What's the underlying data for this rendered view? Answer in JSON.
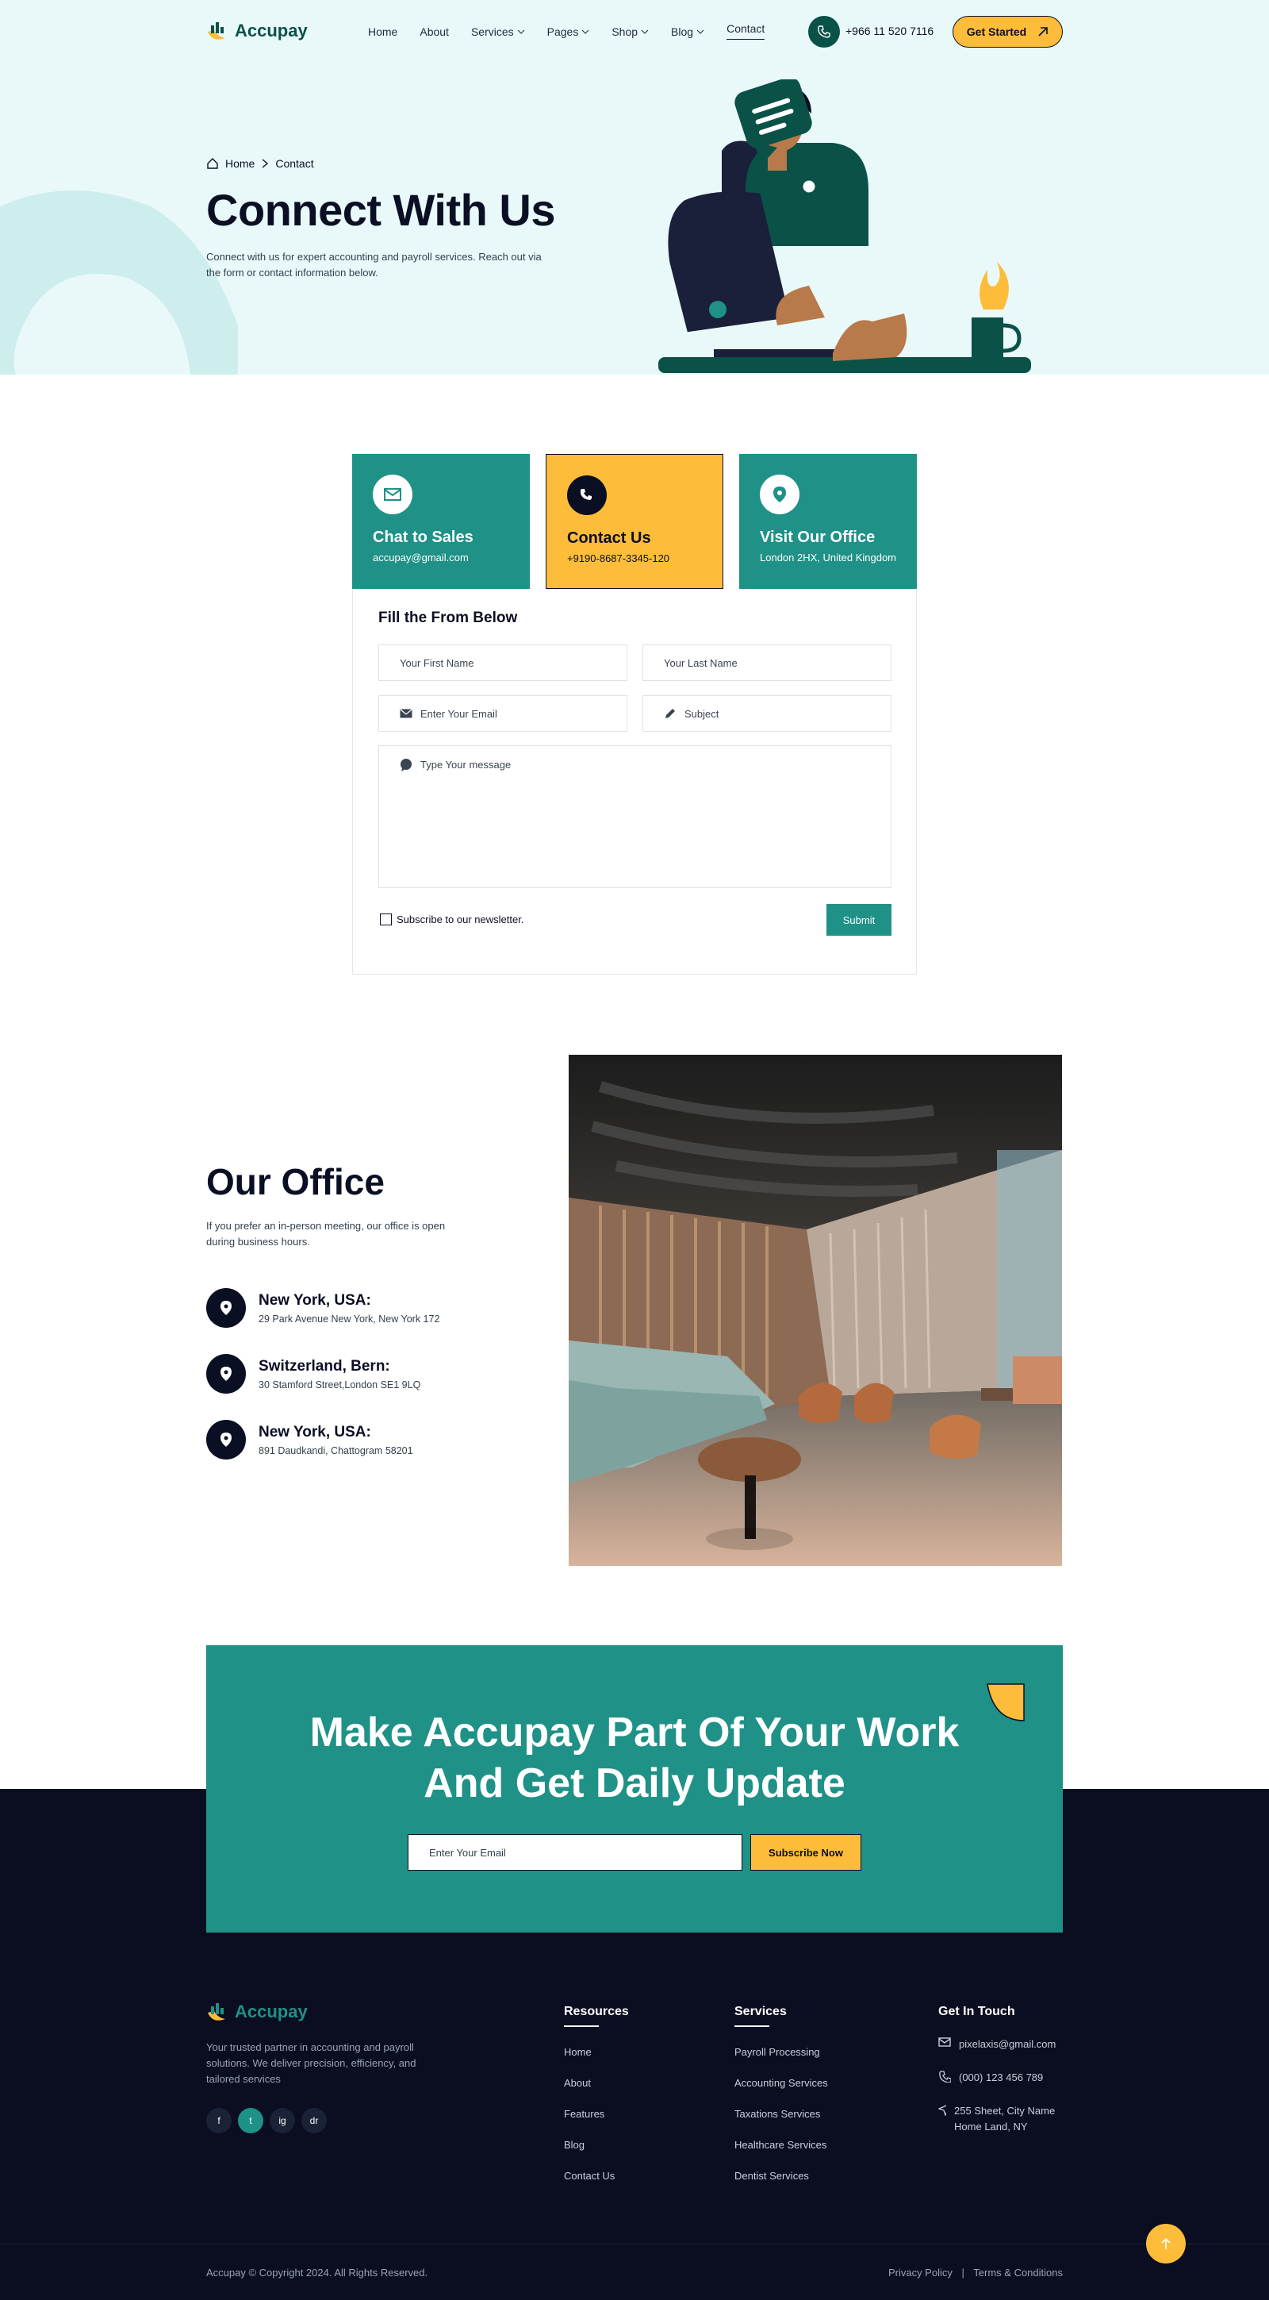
{
  "brand": {
    "name": "Accupay"
  },
  "nav": {
    "items": [
      "Home",
      "About",
      "Services",
      "Pages",
      "Shop",
      "Blog",
      "Contact"
    ],
    "active": "Contact"
  },
  "header": {
    "phone": "+966 11 520 7116",
    "cta": "Get Started"
  },
  "breadcrumb": {
    "home": "Home",
    "current": "Contact"
  },
  "hero": {
    "title": "Connect With Us",
    "lead": "Connect with us for expert accounting and payroll services. Reach out via the form or contact information below."
  },
  "cards": [
    {
      "title": "Chat to Sales",
      "text": "accupay@gmail.com"
    },
    {
      "title": "Contact Us",
      "text": "+9190-8687-3345-120"
    },
    {
      "title": "Visit Our Office",
      "text": "London 2HX, United Kingdom"
    }
  ],
  "form": {
    "title": "Fill the From Below",
    "first_name": "Your First Name",
    "last_name": "Your Last Name",
    "email": "Enter Your Email",
    "subject": "Subject",
    "message": "Type Your message",
    "newsletter": "Subscribe to our newsletter.",
    "submit": "Submit"
  },
  "office": {
    "title": "Our Office",
    "lead": "If you prefer an in-person meeting, our office is open during business hours.",
    "locations": [
      {
        "name": "New York, USA:",
        "address": "29 Park Avenue New York, New York 172"
      },
      {
        "name": "Switzerland, Bern:",
        "address": "30 Stamford Street,London SE1 9LQ"
      },
      {
        "name": "New York, USA:",
        "address": "891 Daudkandi, Chattogram 58201"
      }
    ]
  },
  "cta": {
    "line1": "Make Accupay Part Of Your Work",
    "line2": "And Get Daily Update",
    "placeholder": "Enter Your Email",
    "button": "Subscribe Now"
  },
  "footer": {
    "about": "Your trusted partner in accounting and payroll solutions. We deliver precision, efficiency, and tailored services",
    "social": [
      "f",
      "t",
      "ig",
      "dr"
    ],
    "resources": {
      "title": "Resources",
      "links": [
        "Home",
        "About",
        "Features",
        "Blog",
        "Contact Us"
      ]
    },
    "services": {
      "title": "Services",
      "links": [
        "Payroll Processing",
        "Accounting Services",
        "Taxations Services",
        "Healthcare Services",
        "Dentist Services"
      ]
    },
    "contact": {
      "title": "Get In Touch",
      "email": "pixelaxis@gmail.com",
      "phone": "(000) 123 456 789",
      "address": "255 Sheet, City Name Home Land, NY"
    },
    "copyright": "Accupay © Copyright 2024. All Rights Reserved.",
    "privacy": "Privacy Policy",
    "separator": "|",
    "terms": "Terms & Conditions"
  },
  "colors": {
    "teal": "#1f9187",
    "dark_teal": "#0a5148",
    "yellow": "#fdbc3a",
    "navy": "#0b0d21",
    "hero_bg": "#e9f9f9"
  }
}
